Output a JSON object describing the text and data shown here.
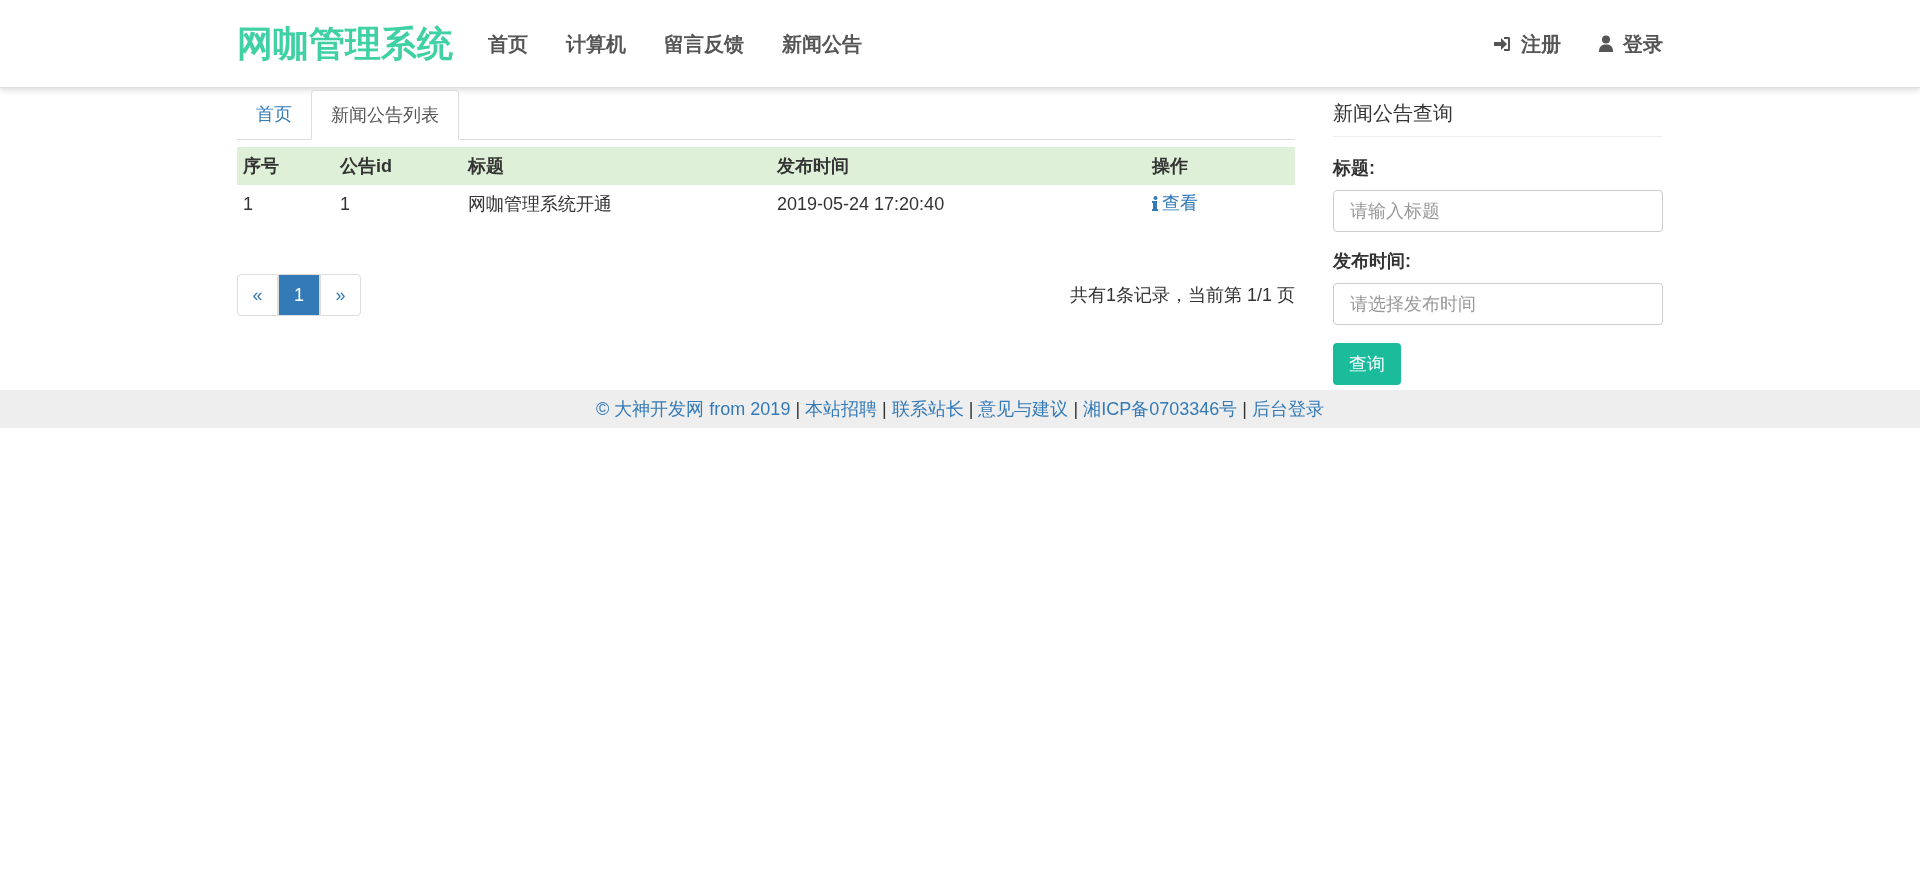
{
  "brand": "网咖管理系统",
  "nav": [
    {
      "label": "首页"
    },
    {
      "label": "计算机"
    },
    {
      "label": "留言反馈"
    },
    {
      "label": "新闻公告"
    }
  ],
  "user_nav": [
    {
      "label": "注册",
      "kind": "register"
    },
    {
      "label": "登录",
      "kind": "login"
    }
  ],
  "tabs": [
    {
      "label": "首页",
      "selected": false
    },
    {
      "label": "新闻公告列表",
      "selected": true
    }
  ],
  "table": {
    "columns": [
      "序号",
      "公告id",
      "标题",
      "发布时间",
      "操作"
    ],
    "rows": [
      {
        "cells": [
          "1",
          "1",
          "网咖管理系统开通",
          "2019-05-24 17:20:40"
        ],
        "action": "查看"
      }
    ]
  },
  "pagination": {
    "prev": "«",
    "next": "»",
    "pages": [
      {
        "label": "1",
        "selected": true
      }
    ]
  },
  "record_info": "共有1条记录，当前第 1/1 页",
  "search_panel": {
    "title": "新闻公告查询",
    "fields": [
      {
        "label": "标题:",
        "placeholder": "请输入标题"
      },
      {
        "label": "发布时间:",
        "placeholder": "请选择发布时间"
      }
    ],
    "button": "查询"
  },
  "footer": {
    "items": [
      {
        "kind": "link",
        "text": "© 大神开发网 from 2019"
      },
      {
        "kind": "separator",
        "text": "|"
      },
      {
        "kind": "link",
        "text": "本站招聘"
      },
      {
        "kind": "separator",
        "text": "|"
      },
      {
        "kind": "link",
        "text": "联系站长"
      },
      {
        "kind": "separator",
        "text": "|"
      },
      {
        "kind": "link",
        "text": "意见与建议"
      },
      {
        "kind": "separator",
        "text": "|"
      },
      {
        "kind": "link",
        "text": "湘ICP备0703346号"
      },
      {
        "kind": "separator",
        "text": "|"
      },
      {
        "kind": "link",
        "text": "后台登录"
      }
    ]
  }
}
